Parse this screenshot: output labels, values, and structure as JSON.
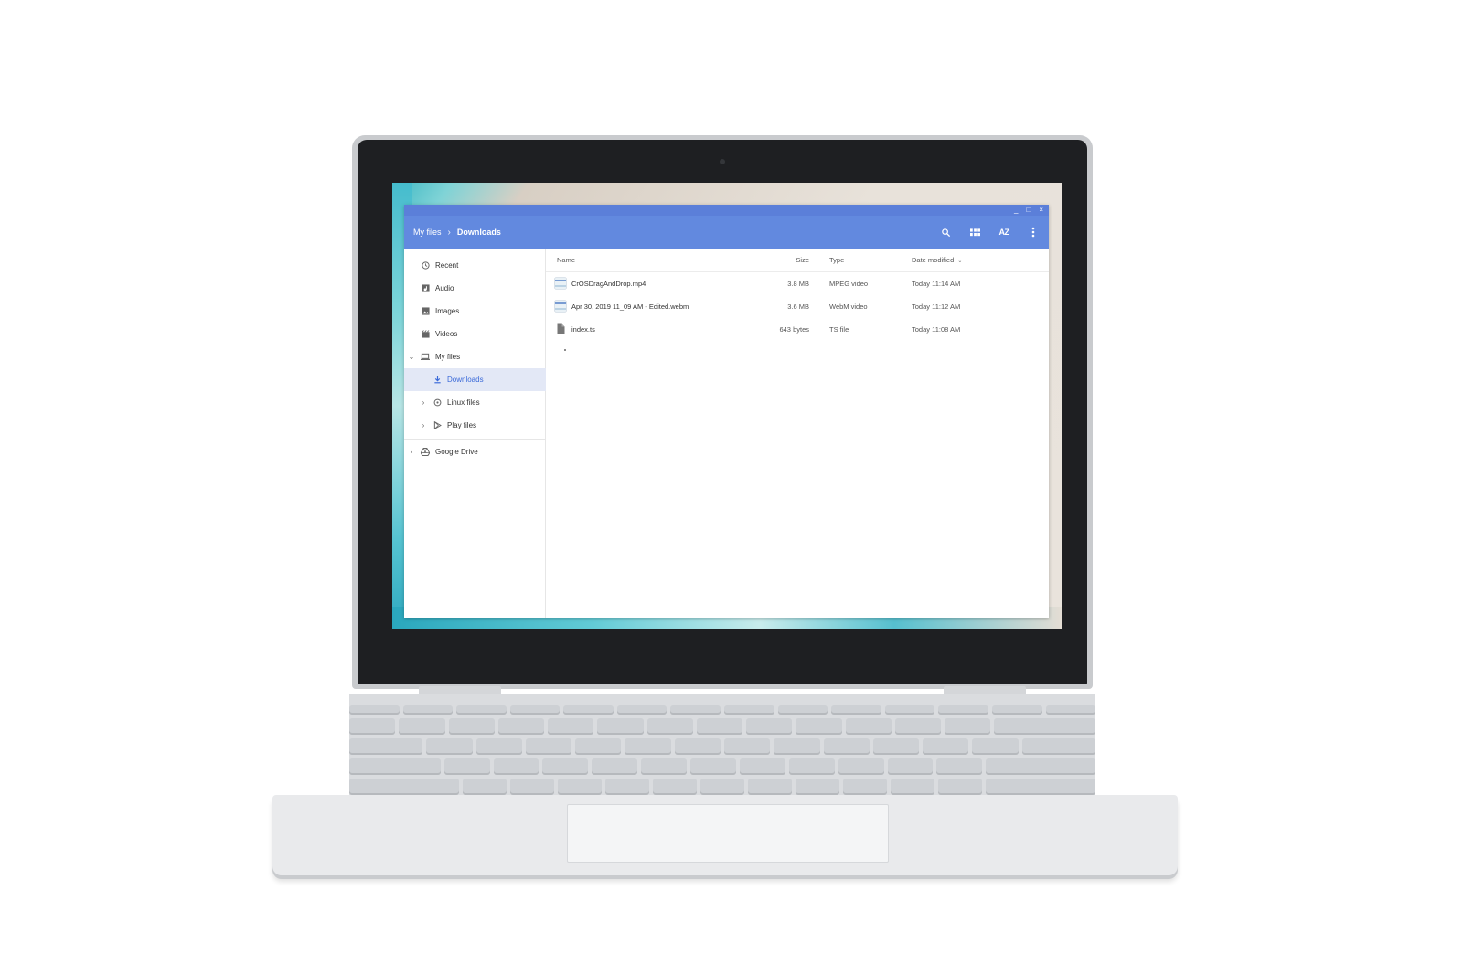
{
  "window": {
    "controls": [
      "_",
      "□",
      "×"
    ]
  },
  "header": {
    "breadcrumb": [
      "My files",
      "Downloads"
    ],
    "separator": "›",
    "tools": [
      "search-icon",
      "grid-view-icon",
      "sort-az-icon",
      "more-vert-icon"
    ],
    "sort_label": "AZ"
  },
  "sidebar": {
    "items": [
      {
        "label": "Recent",
        "icon": "clock-icon"
      },
      {
        "label": "Audio",
        "icon": "audio-icon"
      },
      {
        "label": "Images",
        "icon": "image-icon"
      },
      {
        "label": "Videos",
        "icon": "video-icon"
      },
      {
        "label": "My files",
        "icon": "laptop-icon",
        "expanded": true
      },
      {
        "label": "Downloads",
        "icon": "download-icon",
        "selected": true
      },
      {
        "label": "Linux files",
        "icon": "linux-icon"
      },
      {
        "label": "Play files",
        "icon": "play-icon"
      },
      {
        "label": "Google Drive",
        "icon": "drive-icon"
      }
    ],
    "chevron_expanded": "⌄",
    "chevron_collapsed": "›"
  },
  "list": {
    "columns": {
      "name": "Name",
      "size": "Size",
      "type": "Type",
      "date": "Date modified"
    },
    "sort_indicator": "⌄",
    "rows": [
      {
        "name": "CrOSDragAndDrop.mp4",
        "size": "3.8 MB",
        "type": "MPEG video",
        "date": "Today 11:14 AM",
        "icon": "video-thumbnail-icon"
      },
      {
        "name": "Apr 30, 2019 11_09 AM - Edited.webm",
        "size": "3.6 MB",
        "type": "WebM video",
        "date": "Today 11:12 AM",
        "icon": "video-thumbnail-icon"
      },
      {
        "name": "index.ts",
        "size": "643 bytes",
        "type": "TS file",
        "date": "Today 11:08 AM",
        "icon": "file-icon"
      }
    ]
  },
  "colors": {
    "header": "#6289df",
    "titlebar": "#5b7fd9",
    "selected_bg": "#e3e8f6",
    "selected_text": "#3b6ad9"
  }
}
